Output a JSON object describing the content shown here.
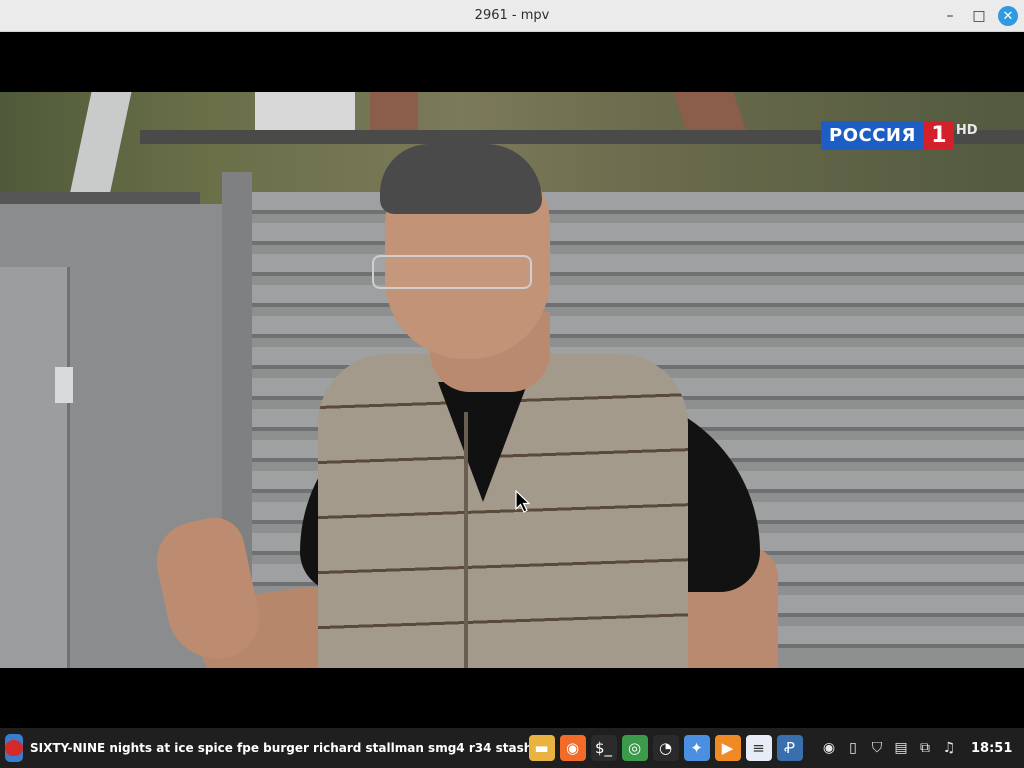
{
  "window": {
    "title": "2961 - mpv",
    "minimize_glyph": "–",
    "maximize_glyph": "□",
    "close_glyph": "✕"
  },
  "video": {
    "channel_name": "РОССИЯ",
    "channel_number": "1",
    "channel_suffix": "HD"
  },
  "taskbar": {
    "active_window_title": "SIXTY-NINE nights at ice spice fpe burger richard stallman smg4 r34 stash",
    "launchers": [
      {
        "icon": "folder-icon",
        "glyph": "▬",
        "color": "#e9b341"
      },
      {
        "icon": "firefox-icon",
        "glyph": "◉",
        "color": "#f36b2a"
      },
      {
        "icon": "terminal-icon",
        "glyph": "$_",
        "color": "#2b2b2b"
      },
      {
        "icon": "chrome-icon",
        "glyph": "◎",
        "color": "#3c9b4b"
      },
      {
        "icon": "disk-usage-icon",
        "glyph": "◔",
        "color": "#2a2a2a"
      },
      {
        "icon": "app-grid-icon",
        "glyph": "✦",
        "color": "#4a8fe0"
      },
      {
        "icon": "media-player-icon",
        "glyph": "▶",
        "color": "#f08a24"
      },
      {
        "icon": "text-editor-icon",
        "glyph": "≡",
        "color": "#e7ecf6"
      },
      {
        "icon": "python-icon",
        "glyph": "Ꝓ",
        "color": "#3a6fae"
      }
    ],
    "tray_icons": [
      "obs-icon",
      "clipboard-icon",
      "shield-icon",
      "document-icon",
      "network-icon",
      "music-icon"
    ],
    "tray_glyphs": [
      "◉",
      "▯",
      "⛉",
      "▤",
      "⧉",
      "♫"
    ],
    "clock": "18:51",
    "power_glyph": "⏻"
  }
}
